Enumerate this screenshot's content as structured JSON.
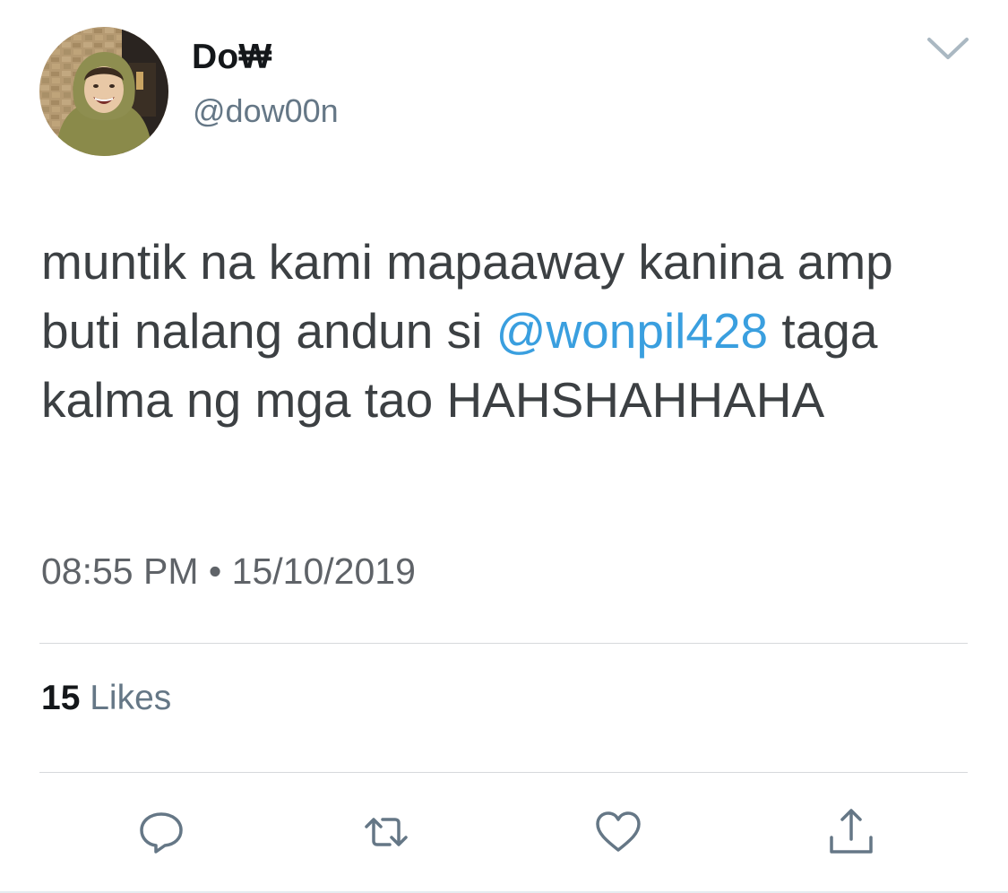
{
  "author": {
    "display_name": "Do₩",
    "handle": "@dow00n",
    "avatar_icon": "profile-photo"
  },
  "tweet": {
    "text_part1": "muntik na kami mapaaway kanina amp buti nalang andun si ",
    "mention": "@wonpil428",
    "text_part2": " taga kalma ng mga tao HAHSHAHHAHA",
    "time": "08:55 PM",
    "separator": "•",
    "date": "15/10/2019"
  },
  "stats": {
    "likes_count": "15",
    "likes_label": "Likes"
  },
  "actions": {
    "reply_icon": "reply-icon",
    "retweet_icon": "retweet-icon",
    "like_icon": "heart-icon",
    "share_icon": "share-icon",
    "menu_icon": "chevron-down-icon"
  },
  "colors": {
    "mention": "#3a9fdf",
    "secondary_text": "#657786",
    "icon": "#657786",
    "divider": "#d6d9dc"
  }
}
